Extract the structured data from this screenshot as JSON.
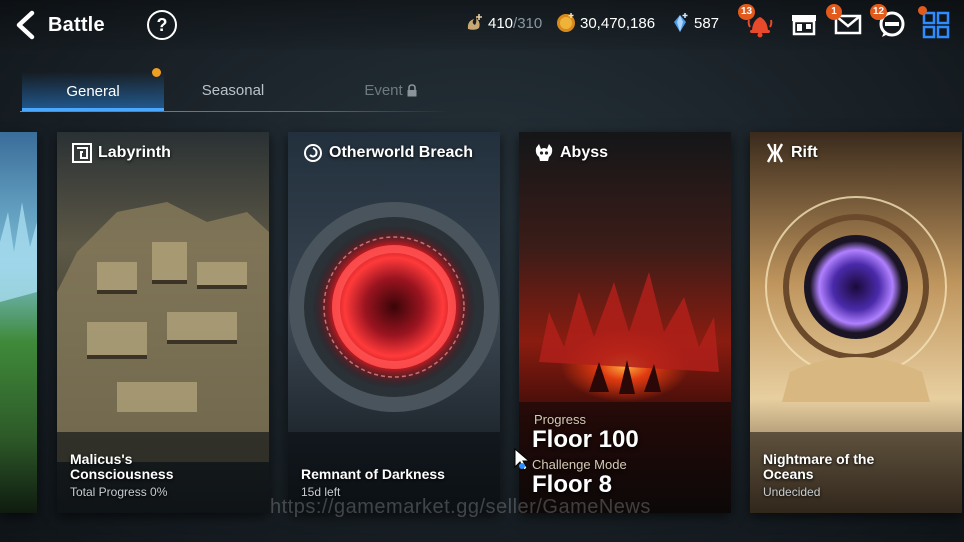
{
  "header": {
    "title": "Battle",
    "resources": [
      {
        "name": "stamina",
        "icon": "stamina-icon",
        "value": "410",
        "max": "/310"
      },
      {
        "name": "gold",
        "icon": "gold-coin-icon",
        "value": "30,470,186"
      },
      {
        "name": "crystal",
        "icon": "crystal-icon",
        "value": "587"
      }
    ],
    "badges": {
      "notifications": "13",
      "mail": "1",
      "chat": "12"
    }
  },
  "tabs": [
    {
      "label": "General",
      "state": "active"
    },
    {
      "label": "Seasonal",
      "state": "inactive"
    },
    {
      "label": "Event",
      "state": "locked"
    }
  ],
  "cards": {
    "labyrinth": {
      "title": "Labyrinth",
      "name": "Malicus's Consciousness",
      "sub": "Total Progress 0%"
    },
    "otherworld": {
      "title": "Otherworld Breach",
      "name": "Remnant of Darkness",
      "sub": "15d left"
    },
    "abyss": {
      "title": "Abyss",
      "progress_label": "Progress",
      "progress_value": "Floor 100",
      "challenge_label": "Challenge Mode",
      "challenge_value": "Floor 8"
    },
    "rift": {
      "title": "Rift",
      "name": "Nightmare of the Oceans",
      "sub": "Undecided"
    }
  },
  "watermark": "https://gamemarket.gg/seller/GameNews",
  "colors": {
    "accent": "#4aa8ff",
    "badge": "#e25a1c",
    "blue_icon": "#2f8cff"
  }
}
